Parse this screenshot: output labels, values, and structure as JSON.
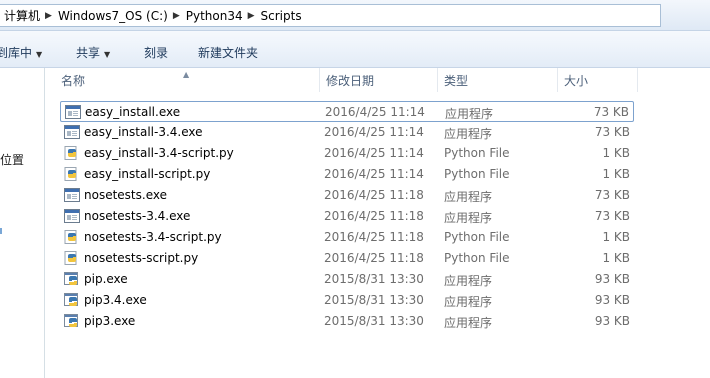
{
  "address": {
    "crumbs": [
      "计算机",
      "Windows7_OS (C:)",
      "Python34",
      "Scripts"
    ]
  },
  "toolbar": {
    "include_label": "到库中",
    "share_label": "共享",
    "burn_label": "刻录",
    "new_folder_label": "新建文件夹"
  },
  "navpane": {
    "partial_label": "位置"
  },
  "columns": {
    "name": "名称",
    "date": "修改日期",
    "type": "类型",
    "size": "大小"
  },
  "files": [
    {
      "name": "easy_install.exe",
      "date": "2016/4/25 11:14",
      "type": "应用程序",
      "size": "73 KB",
      "icon": "exe-window-icon"
    },
    {
      "name": "easy_install-3.4.exe",
      "date": "2016/4/25 11:14",
      "type": "应用程序",
      "size": "73 KB",
      "icon": "exe-window-icon"
    },
    {
      "name": "easy_install-3.4-script.py",
      "date": "2016/4/25 11:14",
      "type": "Python File",
      "size": "1 KB",
      "icon": "python-icon"
    },
    {
      "name": "easy_install-script.py",
      "date": "2016/4/25 11:14",
      "type": "Python File",
      "size": "1 KB",
      "icon": "python-icon"
    },
    {
      "name": "nosetests.exe",
      "date": "2016/4/25 11:18",
      "type": "应用程序",
      "size": "73 KB",
      "icon": "exe-window-icon"
    },
    {
      "name": "nosetests-3.4.exe",
      "date": "2016/4/25 11:18",
      "type": "应用程序",
      "size": "73 KB",
      "icon": "exe-window-icon"
    },
    {
      "name": "nosetests-3.4-script.py",
      "date": "2016/4/25 11:18",
      "type": "Python File",
      "size": "1 KB",
      "icon": "python-icon"
    },
    {
      "name": "nosetests-script.py",
      "date": "2016/4/25 11:18",
      "type": "Python File",
      "size": "1 KB",
      "icon": "python-icon"
    },
    {
      "name": "pip.exe",
      "date": "2015/8/31 13:30",
      "type": "应用程序",
      "size": "93 KB",
      "icon": "pip-exe-icon"
    },
    {
      "name": "pip3.4.exe",
      "date": "2015/8/31 13:30",
      "type": "应用程序",
      "size": "93 KB",
      "icon": "pip-exe-icon"
    },
    {
      "name": "pip3.exe",
      "date": "2015/8/31 13:30",
      "type": "应用程序",
      "size": "93 KB",
      "icon": "pip-exe-icon"
    }
  ],
  "colors": {
    "accent": "#7da2ce",
    "header_text": "#4c607a",
    "meta_text": "#6d6d6d"
  }
}
